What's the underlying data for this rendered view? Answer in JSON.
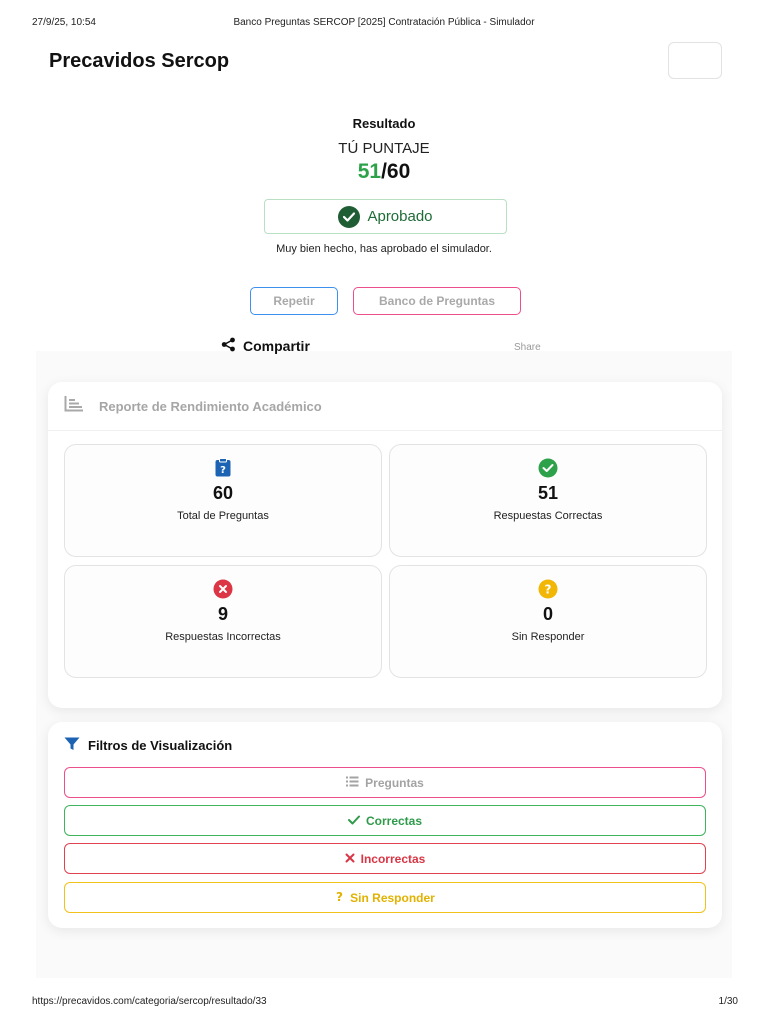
{
  "print_header": {
    "datetime": "27/9/25, 10:54",
    "title": "Banco Preguntas SERCOP [2025] Contratación Pública - Simulador"
  },
  "print_footer": {
    "url": "https://precavidos.com/categoria/sercop/resultado/33",
    "page": "1/30"
  },
  "navbar": {
    "brand": "Precavidos Sercop"
  },
  "result": {
    "heading": "Resultado",
    "score_label": "TÚ PUNTAJE",
    "score_correct": "51",
    "score_total": "/60",
    "status": "Aprobado",
    "message": "Muy bien hecho, has aprobado el simulador."
  },
  "actions": {
    "retry_label": "Repetir",
    "bank_label": "Banco de Preguntas"
  },
  "share": {
    "label": "Compartir",
    "alt_label": "Share"
  },
  "report": {
    "title": "Reporte de Rendimiento Académico",
    "stats": [
      {
        "value": "60",
        "label": "Total de Preguntas",
        "icon": "clipboard-question-icon",
        "color": "#1d63b3"
      },
      {
        "value": "51",
        "label": "Respuestas Correctas",
        "icon": "check-circle-icon",
        "color": "#2ea24a"
      },
      {
        "value": "9",
        "label": "Respuestas Incorrectas",
        "icon": "x-circle-icon",
        "color": "#dc3545"
      },
      {
        "value": "0",
        "label": "Sin Responder",
        "icon": "question-circle-icon",
        "color": "#f2b705"
      }
    ]
  },
  "filters": {
    "title": "Filtros de Visualización",
    "buttons": [
      {
        "label": "Preguntas",
        "icon": "list-icon"
      },
      {
        "label": "Correctas",
        "icon": "check-icon"
      },
      {
        "label": "Incorrectas",
        "icon": "x-icon"
      },
      {
        "label": "Sin Responder",
        "icon": "question-icon"
      }
    ]
  },
  "colors": {
    "success": "#2ea24a",
    "danger": "#dc3545",
    "warning": "#f2b705",
    "primary": "#1d63b3",
    "pink": "#ec4f8c",
    "blue_outline": "#3d8ff0"
  }
}
